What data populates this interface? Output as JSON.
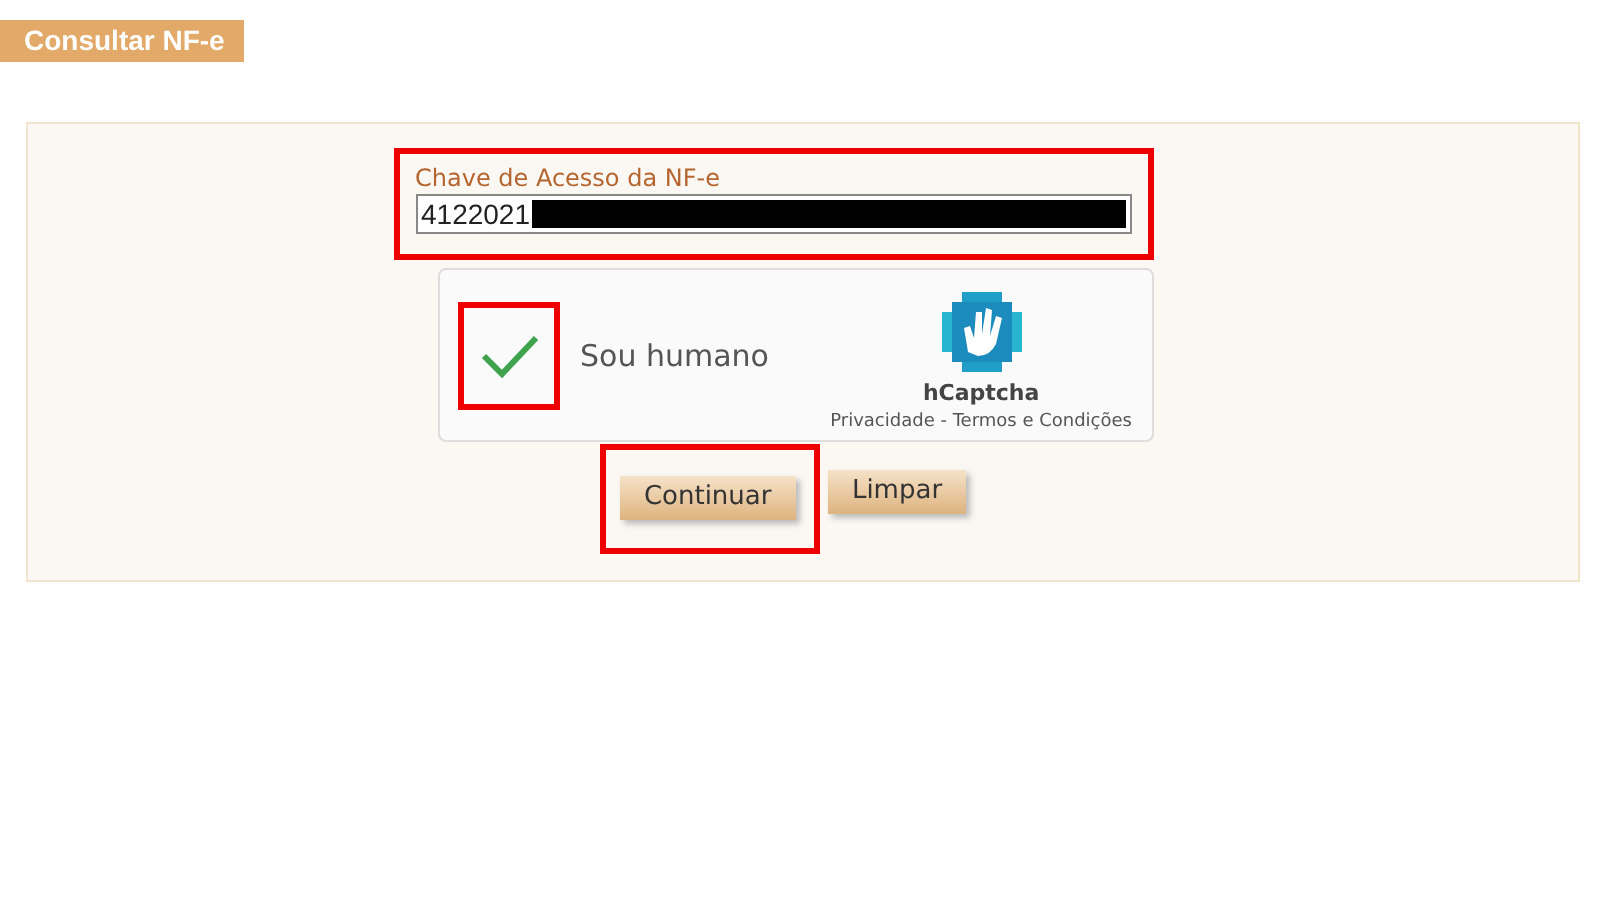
{
  "header": {
    "title": "Consultar NF-e"
  },
  "access_key": {
    "label": "Chave de Acesso da NF-e",
    "value": "4122021",
    "redacted": true
  },
  "captcha": {
    "checked": true,
    "label": "Sou humano",
    "brand": "hCaptcha",
    "links": "Privacidade - Termos e Condições"
  },
  "buttons": [
    {
      "label": "Continuar",
      "highlighted": true
    },
    {
      "label": "Limpar",
      "highlighted": false
    }
  ]
}
